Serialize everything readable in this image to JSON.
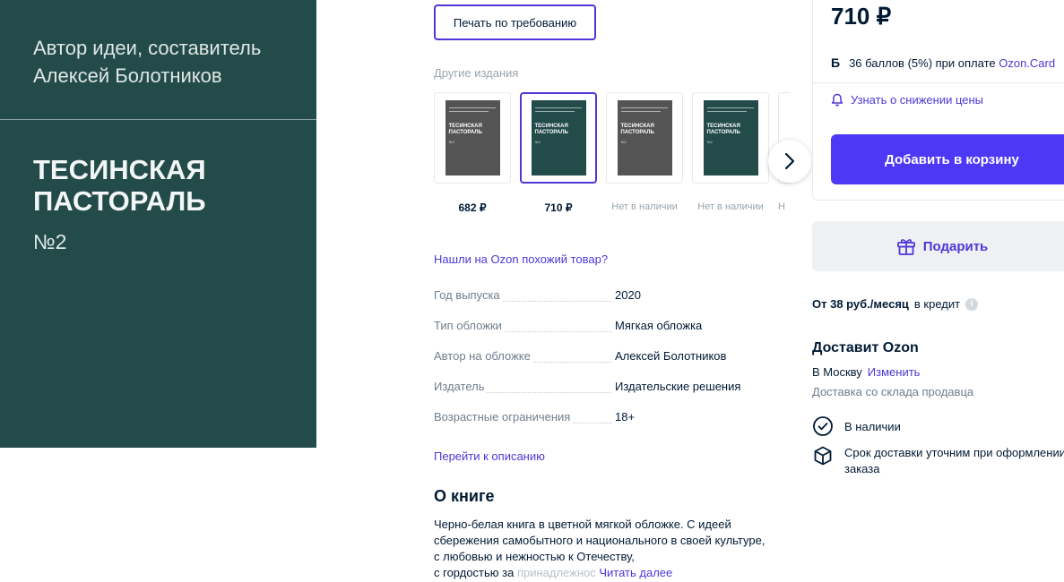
{
  "cover": {
    "author_line1": "Автор идеи, составитель",
    "author_line2": "Алексей Болотников",
    "title_line1": "ТЕСИНСКАЯ",
    "title_line2": "ПАСТОРАЛЬ",
    "number": "№2",
    "bg_color": "#234b4a"
  },
  "print_on_demand": {
    "label": "Печать по требованию"
  },
  "other_editions": {
    "label": "Другие издания",
    "items": [
      {
        "price": "682 ₽",
        "selected": false,
        "cover_color": "#545454",
        "cover_title": "ТЕСИНСКАЯ ПАСТОРАЛЬ",
        "cover_num": "№2"
      },
      {
        "price": "710 ₽",
        "selected": true,
        "cover_color": "#234b4a",
        "cover_title": "ТЕСИНСКАЯ ПАСТОРАЛЬ",
        "cover_num": "№2"
      },
      {
        "price": "Нет в наличии",
        "selected": false,
        "cover_color": "#545454",
        "cover_title": "ТЕСИНСКАЯ ПАСТОРАЛЬ",
        "cover_num": "№2"
      },
      {
        "price": "Нет в наличии",
        "selected": false,
        "cover_color": "#234b4a",
        "cover_title": "ТЕСИНСКАЯ ПАСТОРАЛЬ",
        "cover_num": "№2"
      },
      {
        "price": "Н",
        "selected": false,
        "cover_color": "#545454",
        "cover_title": "",
        "cover_num": ""
      }
    ],
    "next_icon": "chevron-right-icon"
  },
  "similar_link": "Нашли на Ozon похожий товар?",
  "attributes": [
    {
      "key": "Год выпуска",
      "value": "2020"
    },
    {
      "key": "Тип обложки",
      "value": "Мягкая обложка"
    },
    {
      "key": "Автор на обложке",
      "value": "Алексей Болотников"
    },
    {
      "key": "Издатель",
      "value": "Издательские решения"
    },
    {
      "key": "Возрастные ограничения",
      "value": "18+"
    }
  ],
  "to_description": "Перейти к описанию",
  "about": {
    "heading": "О книге",
    "line1": "Черно-белая книга в цветной мягкой обложке. С идеей",
    "line2": "сбережения самобытного и национального в своей культуре,",
    "line3": "с любовью и нежностью к Отечеству,",
    "line4_start": "с гордостью за ",
    "line4_fade": "принадлежнос",
    "read_more": "Читать далее"
  },
  "buy_box": {
    "price": "710 ₽",
    "bonus_letter": "Б",
    "bonus_text": "36 баллов (5%) при оплате ",
    "bonus_link": "Ozon.Card",
    "notify_text": "Узнать о снижении цены",
    "cart_button": "Добавить в корзину",
    "accent_color": "#4c38f5"
  },
  "gift_button": "Подарить",
  "credit": {
    "bold": "От 38 руб./месяц",
    "text": "в кредит",
    "info_icon": "i"
  },
  "delivery": {
    "heading": "Доставит Ozon",
    "city": "В Москву",
    "change_link": "Изменить",
    "warehouse": "Доставка со склада продавца",
    "in_stock": "В наличии",
    "term": "Срок доставки уточним при оформлении заказа"
  }
}
